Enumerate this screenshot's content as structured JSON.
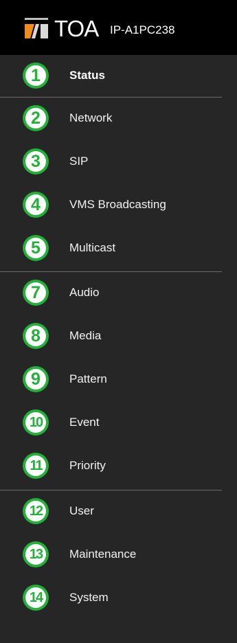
{
  "header": {
    "brand": "TOA",
    "model": "IP-A1PC238"
  },
  "nav": {
    "items": [
      {
        "number": "1",
        "label": "Status",
        "active": true
      },
      {
        "number": "2",
        "label": "Network"
      },
      {
        "number": "3",
        "label": "SIP"
      },
      {
        "number": "4",
        "label": "VMS Broadcasting"
      },
      {
        "number": "5",
        "label": "Multicast"
      },
      {
        "number": "7",
        "label": "Audio"
      },
      {
        "number": "8",
        "label": "Media"
      },
      {
        "number": "9",
        "label": "Pattern"
      },
      {
        "number": "10",
        "label": "Event"
      },
      {
        "number": "11",
        "label": "Priority"
      },
      {
        "number": "12",
        "label": "User"
      },
      {
        "number": "13",
        "label": "Maintenance"
      },
      {
        "number": "14",
        "label": "System"
      }
    ]
  },
  "colors": {
    "header_bg": "#000000",
    "sidebar_bg": "#262626",
    "badge_green": "#22b238",
    "logo_orange": "#f08c1e",
    "text": "#f2f2f2",
    "divider": "#6a6a6a"
  }
}
